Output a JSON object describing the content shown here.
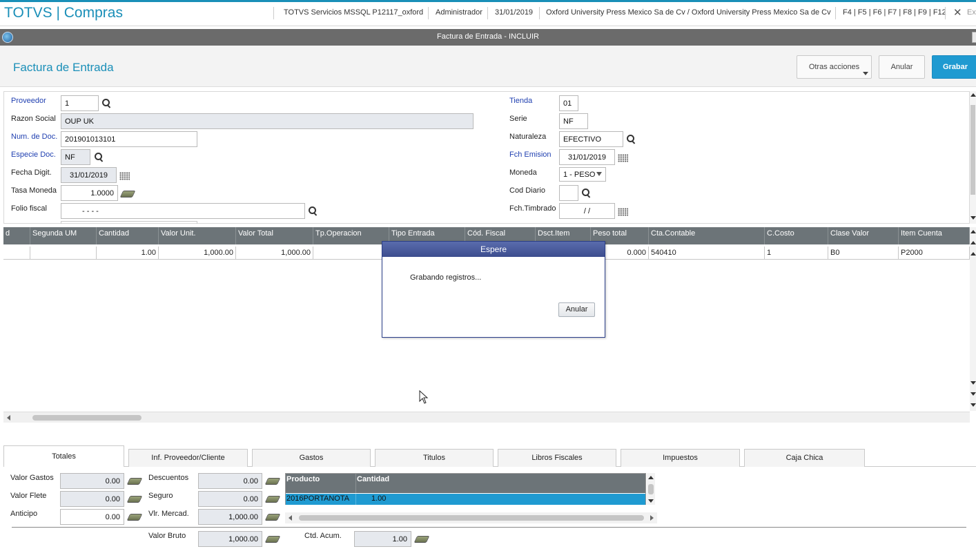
{
  "topbar": {
    "app_title": "TOTVS | Compras",
    "environment": "TOTVS Servicios MSSQL P12117_oxford",
    "user": "Administrador",
    "date": "31/01/2019",
    "company": "Oxford University Press Mexico Sa de Cv / Oxford University Press Mexico Sa de Cv",
    "shortcuts": "F4 | F5 | F6 | F7 | F8 | F9 | F12",
    "close_label": "✕",
    "exit_label": "Ex"
  },
  "window": {
    "title": "Factura de Entrada - INCLUIR"
  },
  "header": {
    "page_title": "Factura de Entrada",
    "more_actions_label": "Otras acciones",
    "cancel_label": "Anular",
    "save_label": "Grabar"
  },
  "form": {
    "proveedor": {
      "label": "Proveedor",
      "value": "1"
    },
    "razon_social": {
      "label": "Razon Social",
      "value": "OUP UK"
    },
    "num_doc": {
      "label": "Num. de Doc.",
      "value": "201901013101"
    },
    "especie_doc": {
      "label": "Especie Doc.",
      "value": "NF"
    },
    "fecha_digit": {
      "label": "Fecha Digit.",
      "value": "31/01/2019"
    },
    "tasa_moneda": {
      "label": "Tasa Moneda",
      "value": "1.0000"
    },
    "folio_fiscal": {
      "label": "Folio fiscal",
      "value": "-   -   -   -"
    },
    "tienda": {
      "label": "Tienda",
      "value": "01"
    },
    "serie": {
      "label": "Serie",
      "value": "NF"
    },
    "naturaleza": {
      "label": "Naturaleza",
      "value": "EFECTIVO"
    },
    "fch_emision": {
      "label": "Fch Emision",
      "value": "31/01/2019"
    },
    "moneda": {
      "label": "Moneda",
      "value": "1 - PESO"
    },
    "cod_diario": {
      "label": "Cod Diario",
      "value": ""
    },
    "fch_timbrado": {
      "label": "Fch.Timbrado",
      "value": "/ /"
    }
  },
  "grid": {
    "columns": [
      "d",
      "Segunda UM",
      "Cantidad",
      "Valor Unit.",
      "Valor Total",
      "Tp.Operacion",
      "Tipo Entrada",
      "Cód. Fiscal",
      "Dsct.Item",
      "Peso total",
      "Cta.Contable",
      "C.Costo",
      "Clase Valor",
      "Item Cuenta"
    ],
    "rows": [
      [
        "",
        "",
        "1.00",
        "1,000.00",
        "1,000.00",
        "",
        "",
        "",
        "",
        "0.000",
        "540410",
        "1",
        "B0",
        "P2000"
      ]
    ]
  },
  "modal": {
    "title": "Espere",
    "message": "Grabando registros...",
    "cancel_label": "Anular"
  },
  "tabs": [
    "Totales",
    "Inf. Proveedor/Cliente",
    "Gastos",
    "Titulos",
    "Libros Fiscales",
    "Impuestos",
    "Caja Chica"
  ],
  "totals": {
    "valor_gastos": {
      "label": "Valor Gastos",
      "value": "0.00"
    },
    "valor_flete": {
      "label": "Valor Flete",
      "value": "0.00"
    },
    "anticipo": {
      "label": "Anticipo",
      "value": "0.00"
    },
    "descuentos": {
      "label": "Descuentos",
      "value": "0.00"
    },
    "seguro": {
      "label": "Seguro",
      "value": "0.00"
    },
    "vlr_mercad": {
      "label": "Vlr. Mercad.",
      "value": "1,000.00"
    },
    "valor_bruto": {
      "label": "Valor Bruto",
      "value": "1,000.00"
    },
    "ctd_acum": {
      "label": "Ctd. Acum.",
      "value": "1.00"
    },
    "product_grid": {
      "col_producto": "Producto",
      "col_cantidad": "Cantidad",
      "row_producto": "2016PORTANOTA",
      "row_cantidad": "1.00"
    }
  }
}
